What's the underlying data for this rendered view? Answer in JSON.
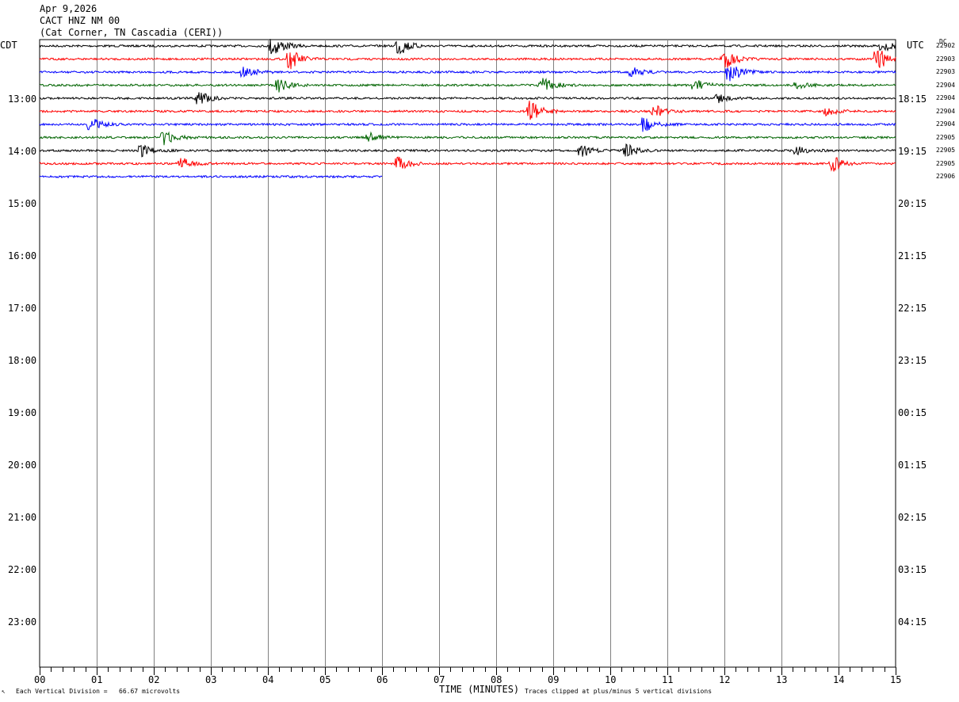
{
  "header": {
    "date": "Apr 9,2026",
    "station": "CACT HNZ NM 00",
    "location": "(Cat Corner, TN Cascadia (CERI))"
  },
  "left_tz": "CDT",
  "right_tz": "UTC",
  "dc_label": "DC",
  "footer": {
    "scale_note": "Each Vertical Division =   66.67 microvolts",
    "xlabel": "TIME (MINUTES)",
    "clip_note": "Traces clipped at plus/minus 5 vertical divisions",
    "corner_mark": "↖"
  },
  "colors": {
    "black": "#000000",
    "red": "#ff0000",
    "blue": "#0000ff",
    "green": "#006400",
    "grid": "#808080"
  },
  "chart_data": {
    "type": "line",
    "title": "CACT HNZ NM 00",
    "xlabel": "TIME (MINUTES)",
    "xlim": [
      0,
      15
    ],
    "x_ticks": [
      "00",
      "01",
      "02",
      "03",
      "04",
      "05",
      "06",
      "07",
      "08",
      "09",
      "10",
      "11",
      "12",
      "13",
      "14",
      "15"
    ],
    "left_labels": [
      "13:00",
      "14:00",
      "15:00",
      "16:00",
      "17:00",
      "18:00",
      "19:00",
      "20:00",
      "21:00",
      "22:00",
      "23:00"
    ],
    "right_labels": [
      "18:15",
      "19:15",
      "20:15",
      "21:15",
      "22:15",
      "23:15",
      "00:15",
      "01:15",
      "02:15",
      "03:15",
      "04:15"
    ],
    "trace_color_cycle": [
      "#000000",
      "#ff0000",
      "#0000ff",
      "#006400"
    ],
    "dc_offsets": [
      "22902",
      "22903",
      "22903",
      "22904",
      "22904",
      "22904",
      "22904",
      "22905",
      "22905",
      "22905",
      "22906"
    ],
    "traces": [
      {
        "end_min": 15,
        "events": [
          {
            "t": 4.1,
            "amp": 1.0
          },
          {
            "t": 6.3,
            "amp": 0.9
          },
          {
            "t": 14.8,
            "amp": 0.5
          }
        ]
      },
      {
        "end_min": 15,
        "events": [
          {
            "t": 4.4,
            "amp": 0.9
          },
          {
            "t": 12.0,
            "amp": 1.0
          },
          {
            "t": 14.7,
            "amp": 1.0
          }
        ]
      },
      {
        "end_min": 15,
        "events": [
          {
            "t": 3.6,
            "amp": 0.5
          },
          {
            "t": 12.1,
            "amp": 1.0
          },
          {
            "t": 10.4,
            "amp": 0.4
          }
        ]
      },
      {
        "end_min": 15,
        "events": [
          {
            "t": 4.2,
            "amp": 0.6
          },
          {
            "t": 8.8,
            "amp": 0.8
          },
          {
            "t": 11.5,
            "amp": 0.5
          },
          {
            "t": 13.3,
            "amp": 0.3
          }
        ]
      },
      {
        "end_min": 15,
        "events": [
          {
            "t": 2.8,
            "amp": 0.6
          },
          {
            "t": 11.9,
            "amp": 0.4
          }
        ]
      },
      {
        "end_min": 15,
        "events": [
          {
            "t": 8.6,
            "amp": 1.0
          },
          {
            "t": 10.8,
            "amp": 0.5
          },
          {
            "t": 13.8,
            "amp": 0.4
          }
        ]
      },
      {
        "end_min": 15,
        "events": [
          {
            "t": 0.9,
            "amp": 0.6
          },
          {
            "t": 10.6,
            "amp": 0.8
          }
        ]
      },
      {
        "end_min": 15,
        "events": [
          {
            "t": 2.2,
            "amp": 0.8
          },
          {
            "t": 5.8,
            "amp": 0.4
          }
        ]
      },
      {
        "end_min": 15,
        "events": [
          {
            "t": 1.8,
            "amp": 0.5
          },
          {
            "t": 9.5,
            "amp": 0.6
          },
          {
            "t": 10.3,
            "amp": 0.6
          },
          {
            "t": 13.3,
            "amp": 0.4
          }
        ]
      },
      {
        "end_min": 15,
        "events": [
          {
            "t": 2.5,
            "amp": 0.5
          },
          {
            "t": 6.3,
            "amp": 0.6
          },
          {
            "t": 13.9,
            "amp": 0.7
          }
        ]
      },
      {
        "end_min": 6,
        "events": []
      }
    ]
  }
}
